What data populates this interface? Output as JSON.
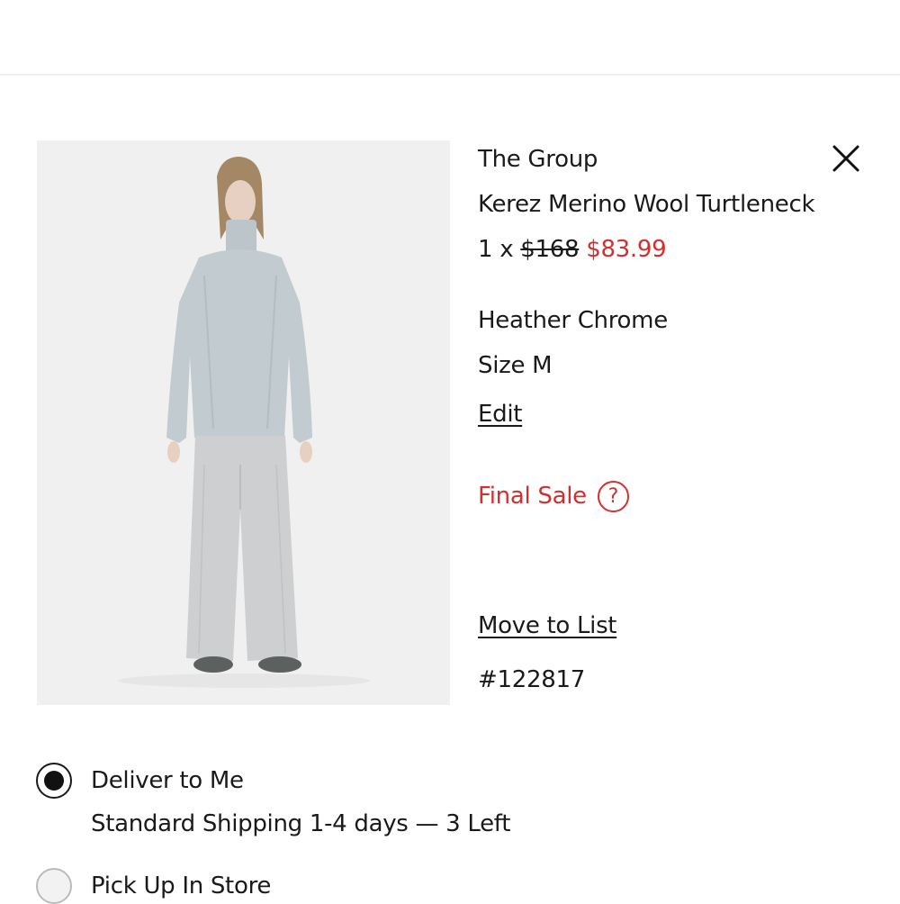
{
  "product": {
    "image_alt": "Model wearing a grey merino wool turtleneck and matching wide-leg pants",
    "brand": "The Group",
    "name": "Kerez Merino Wool Turtleneck",
    "quantity": "1 x",
    "original_price": "$168",
    "sale_price": "$83.99",
    "color": "Heather Chrome",
    "size": "Size M",
    "edit_label": "Edit",
    "final_sale_label": "Final Sale",
    "help_icon_glyph": "?",
    "move_to_list_label": "Move to List",
    "sku": "#122817"
  },
  "fulfillment": {
    "deliver_label": "Deliver to Me",
    "deliver_selected": true,
    "shipping_text": "Standard Shipping 1-4 days — 3 Left",
    "pickup_label": "Pick Up In Store",
    "pickup_selected": false
  },
  "colors": {
    "sale_red": "#d32f2f",
    "text": "#1a1a1a",
    "image_background": "#f0f0f0"
  },
  "icons": {
    "close": "close-icon",
    "help": "help-circle-icon",
    "radio_selected": "radio-selected-icon",
    "radio_unselected": "radio-unselected-icon"
  }
}
